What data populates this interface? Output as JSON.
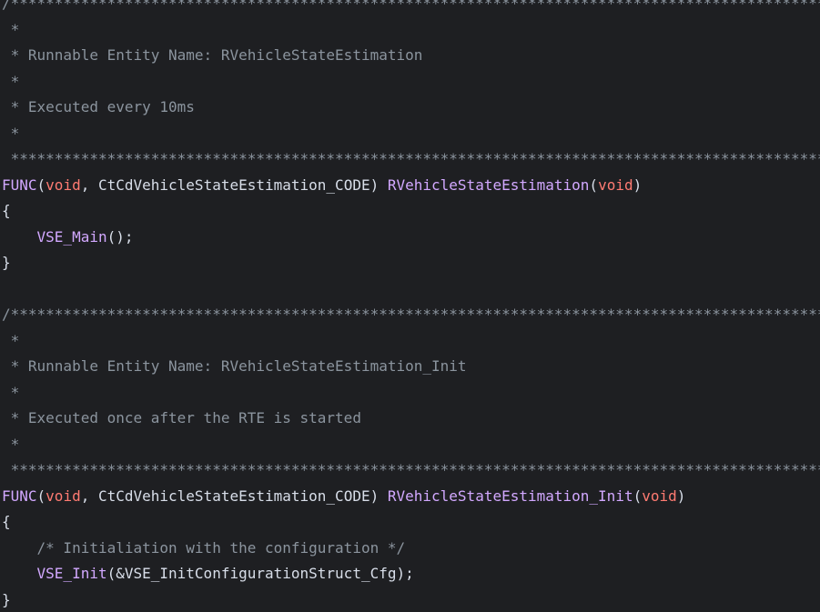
{
  "editor": {
    "background": "#1e1f22",
    "colors": {
      "comment": "#8b949e",
      "macro": "#d2a8ff",
      "keyword": "#ff7b72",
      "text": "#d8dee9"
    },
    "block1": {
      "comment_open": "/*********************************************************************************************************************",
      "star_blank_1": " *",
      "runnable_name": " * Runnable Entity Name: RVehicleStateEstimation",
      "star_blank_2": " *",
      "executed": " * Executed every 10ms",
      "star_blank_3": " *",
      "comment_close": " *********************************************************************************************************************/",
      "func_kw": "FUNC",
      "paren_open": "(",
      "void_1": "void",
      "comma_sp": ", ",
      "code_class": "CtCdVehicleStateEstimation_CODE",
      "paren_close_sp": ") ",
      "func_name": "RVehicleStateEstimation",
      "paren_open_2": "(",
      "void_2": "void",
      "paren_close_2": ")",
      "brace_open": "{",
      "indent": "    ",
      "call_name": "VSE_Main",
      "call_tail": "();",
      "brace_close": "}"
    },
    "block2": {
      "comment_open": "/*********************************************************************************************************************",
      "star_blank_1": " *",
      "runnable_name": " * Runnable Entity Name: RVehicleStateEstimation_Init",
      "star_blank_2": " *",
      "executed": " * Executed once after the RTE is started",
      "star_blank_3": " *",
      "comment_close": " *********************************************************************************************************************/",
      "func_kw": "FUNC",
      "paren_open": "(",
      "void_1": "void",
      "comma_sp": ", ",
      "code_class": "CtCdVehicleStateEstimation_CODE",
      "paren_close_sp": ") ",
      "func_name": "RVehicleStateEstimation_Init",
      "paren_open_2": "(",
      "void_2": "void",
      "paren_close_2": ")",
      "brace_open": "{",
      "indent": "    ",
      "inline_comment": "/* Initialiation with the configuration */",
      "call_name": "VSE_Init",
      "call_tail": "(&VSE_InitConfigurationStruct_Cfg);",
      "brace_close": "}"
    }
  }
}
